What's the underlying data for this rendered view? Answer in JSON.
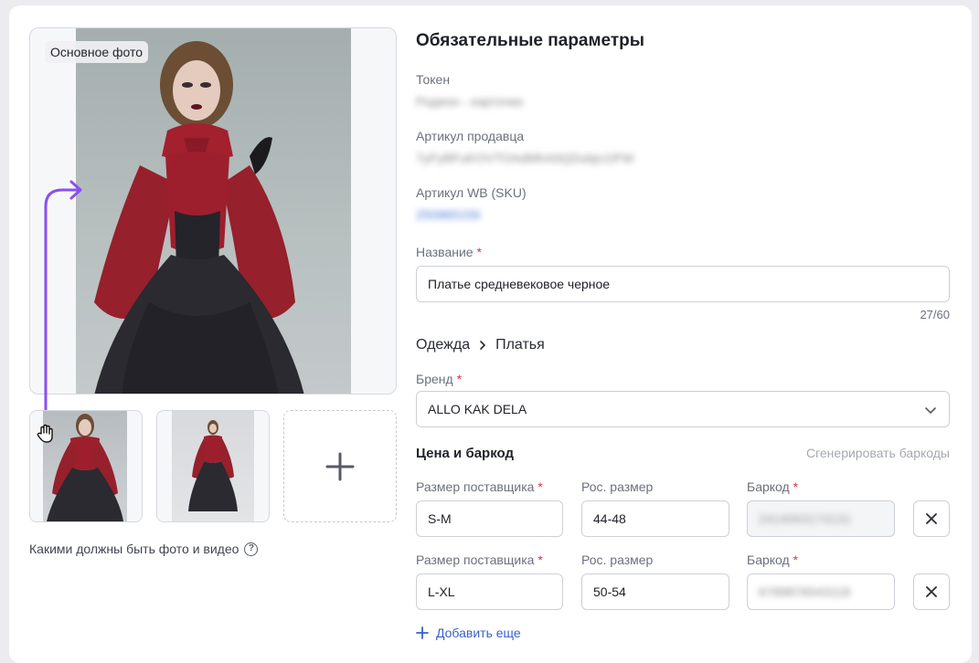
{
  "photos": {
    "main_badge": "Основное фото",
    "help_text": "Какими должны быть фото и видео",
    "help_icon": "?"
  },
  "form": {
    "section_title": "Обязательные параметры",
    "token": {
      "label": "Токен",
      "value": "Родион - карточки"
    },
    "seller_article": {
      "label": "Артикул продавца",
      "value": "7yFyBFuKOVTOAdMhA0QDubjv1IFW"
    },
    "wb_article": {
      "label": "Артикул WB (SKU)",
      "value": "250965159"
    },
    "name": {
      "label": "Название",
      "required": "*",
      "value": "Платье средневековое черное",
      "counter": "27/60"
    },
    "category": {
      "parent": "Одежда",
      "child": "Платья"
    },
    "brand": {
      "label": "Бренд",
      "required": "*",
      "value": "ALLO KAK DELA"
    }
  },
  "pricing": {
    "title": "Цена и баркод",
    "generate_link": "Сгенерировать баркоды",
    "rows": [
      {
        "supplier_size_label": "Размер поставщика",
        "supplier_size_req": "*",
        "supplier_size": "S-M",
        "ru_size_label": "Рос. размер",
        "ru_size": "44-48",
        "barcode_label": "Баркод",
        "barcode_req": "*",
        "barcode": "2414063174131"
      },
      {
        "supplier_size_label": "Размер поставщика",
        "supplier_size_req": "*",
        "supplier_size": "L-XL",
        "ru_size_label": "Рос. размер",
        "ru_size": "50-54",
        "barcode_label": "Баркод",
        "barcode_req": "*",
        "barcode": "6789876543118"
      }
    ],
    "add_more": "Добавить еще"
  },
  "colors": {
    "accent": "#3a5fcf",
    "required": "#e0314b",
    "drag_arrow": "#8a4ff0",
    "dress_red": "#9b1d2a",
    "dress_black": "#1e1e22"
  },
  "icons": [
    "chevron-right-icon",
    "chevron-down-icon",
    "close-icon",
    "plus-icon",
    "help-icon",
    "drag-hand-icon",
    "drag-arrow-icon"
  ]
}
